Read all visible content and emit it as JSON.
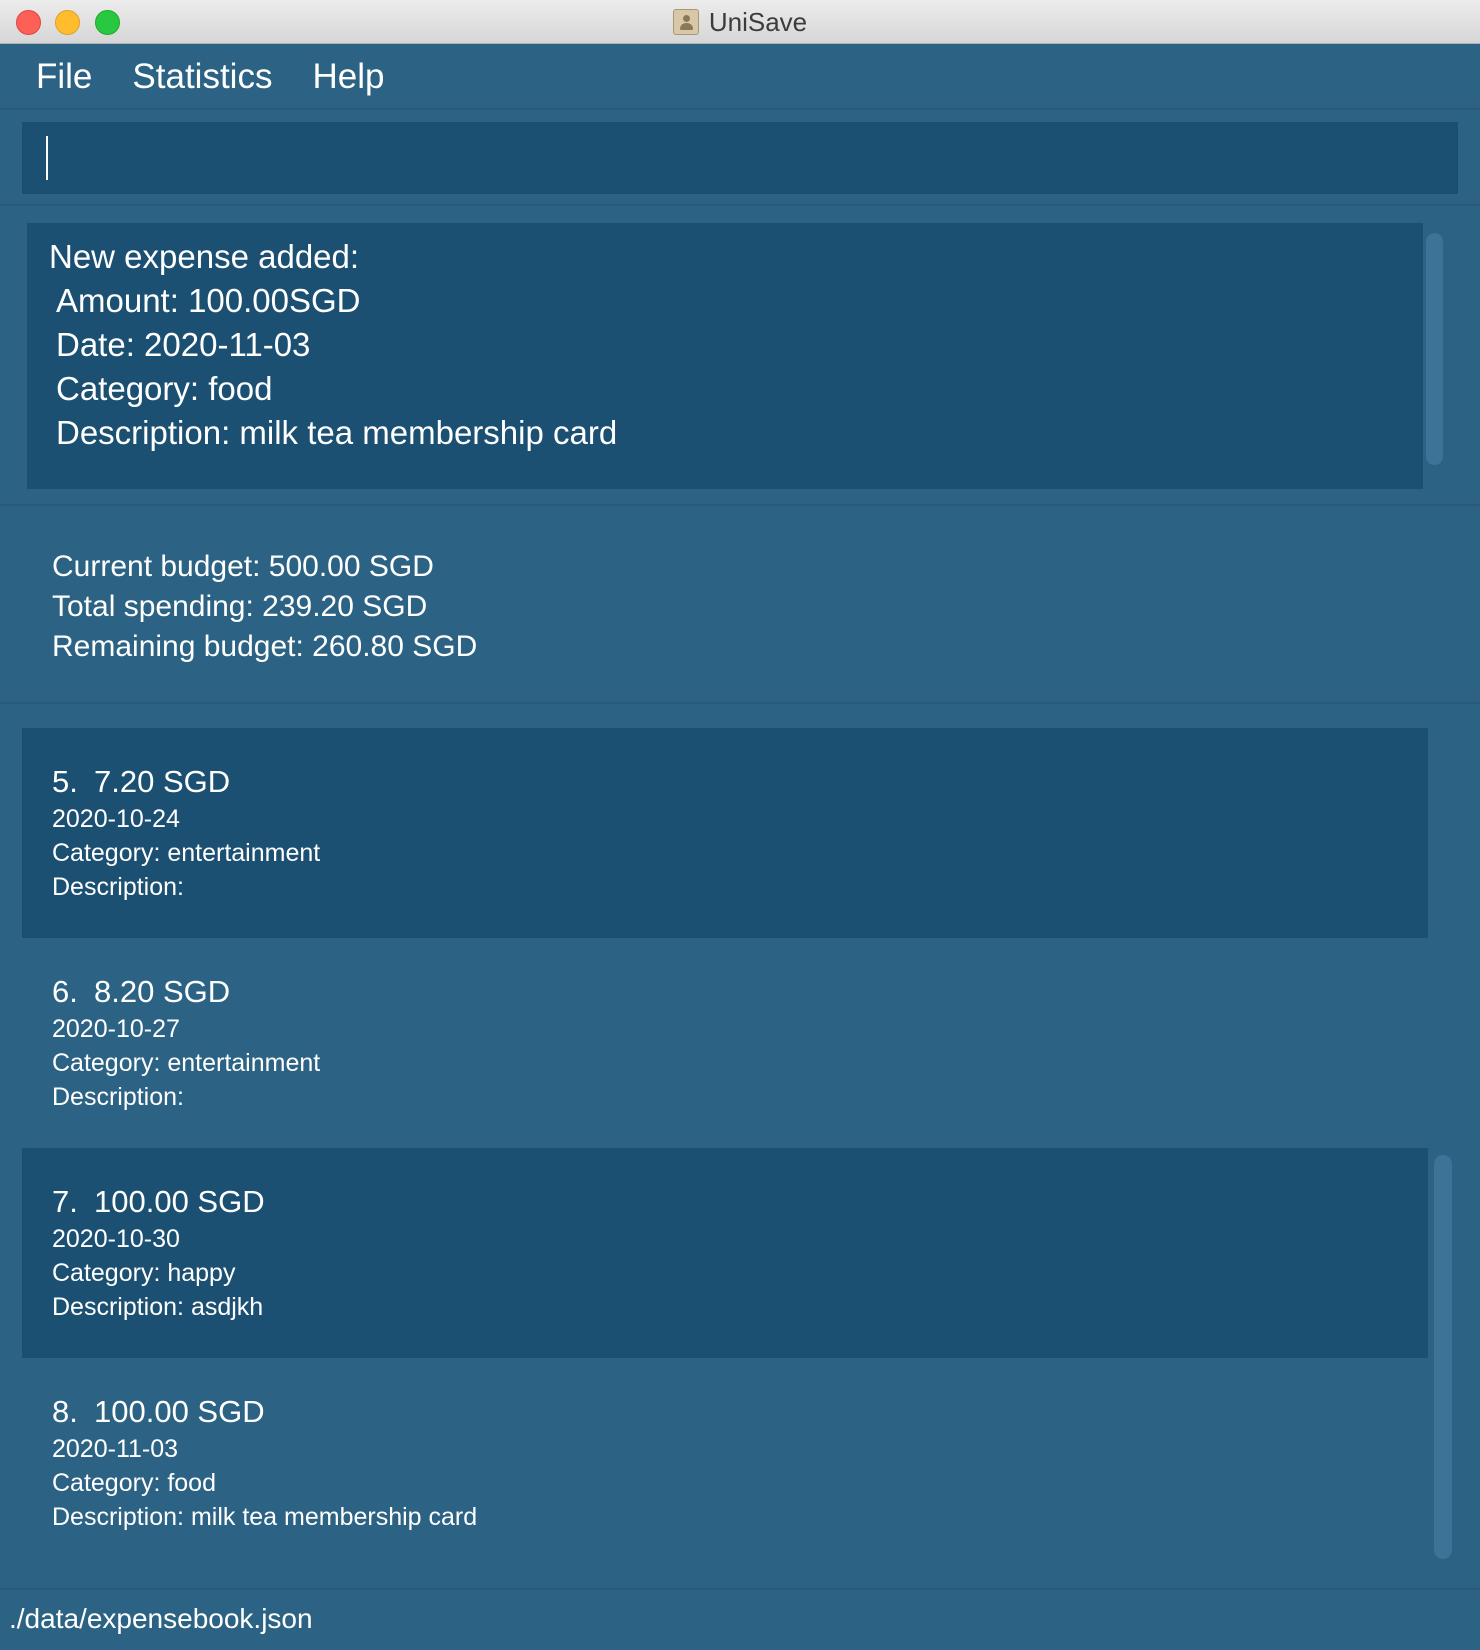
{
  "window": {
    "title": "UniSave",
    "app_icon": "contact-card-icon"
  },
  "menu": {
    "items": [
      "File",
      "Statistics",
      "Help"
    ]
  },
  "command": {
    "value": ""
  },
  "result": {
    "lines": [
      "New expense added:",
      "Amount: 100.00SGD",
      "Date: 2020-11-03",
      "Category: food",
      "Description: milk tea membership card"
    ]
  },
  "budget": {
    "current": "Current budget: 500.00 SGD",
    "spending": "Total spending: 239.20 SGD",
    "remaining": "Remaining budget: 260.80 SGD"
  },
  "expenses": [
    {
      "index": "5.",
      "amount": "7.20 SGD",
      "date": "2020-10-24",
      "category": "Category: entertainment",
      "description": "Description:"
    },
    {
      "index": "6.",
      "amount": "8.20 SGD",
      "date": "2020-10-27",
      "category": "Category: entertainment",
      "description": "Description:"
    },
    {
      "index": "7.",
      "amount": "100.00 SGD",
      "date": "2020-10-30",
      "category": "Category: happy",
      "description": "Description: asdjkh"
    },
    {
      "index": "8.",
      "amount": "100.00 SGD",
      "date": "2020-11-03",
      "category": "Category: food",
      "description": "Description: milk tea membership card"
    }
  ],
  "status": {
    "file_path": "./data/expensebook.json"
  },
  "colors": {
    "background": "#2c6384",
    "panel_dark": "#1c5073",
    "text": "#ffffff"
  }
}
